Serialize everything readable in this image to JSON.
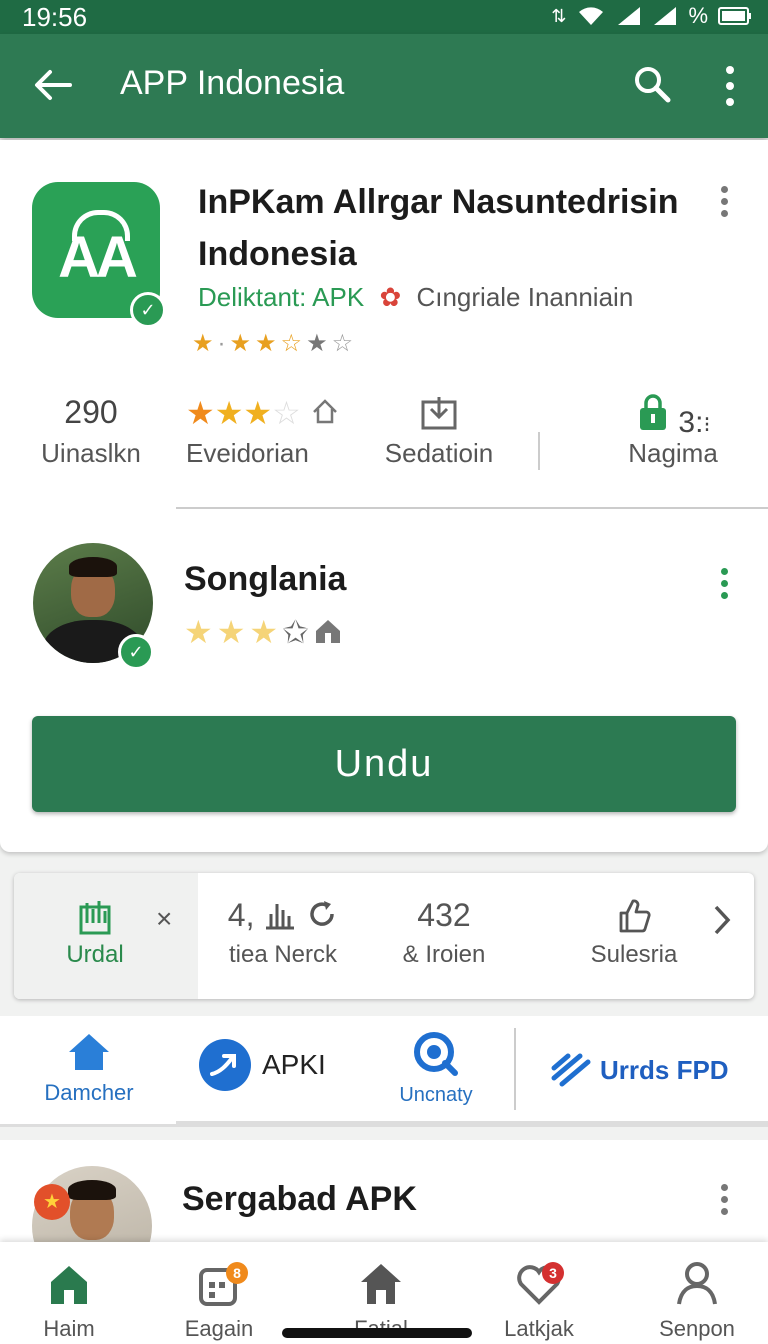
{
  "status_bar": {
    "time": "19:56",
    "battery": "%"
  },
  "app_bar": {
    "title": "APP Indonesia"
  },
  "app": {
    "name": "InPKam Allrgar Nasuntedrisin Indonesia",
    "developer": "Deliktant: APK",
    "category": "Cıngriale Inanniain",
    "rating_stars": 3
  },
  "stats": [
    {
      "value": "290",
      "label": "Uinaslkn"
    },
    {
      "label": "Eveidorian",
      "rating_stars": 3
    },
    {
      "label": "Sedatioin",
      "icon": "download-box-icon"
    },
    {
      "value": "3:",
      "label": "Nagima",
      "icon": "bag-lock-icon"
    }
  ],
  "publisher": {
    "name": "Songlania",
    "rating_stars": 3
  },
  "primary_action": {
    "label": "Undu"
  },
  "quick_actions": {
    "items": [
      {
        "label": "Urdal",
        "icon": "chart-icon"
      },
      {
        "value": "4,",
        "label": "tiea Nerck",
        "icon": "bar-chart-icon"
      },
      {
        "value": "432",
        "label": "& Iroien"
      },
      {
        "label": "Sulesria",
        "icon": "thumbs-up-icon"
      }
    ]
  },
  "category_tabs": [
    {
      "label": "Damcher",
      "icon": "home-icon",
      "active": true
    },
    {
      "label": "APKI",
      "icon": "arrow-circle-icon"
    },
    {
      "label": "Uncnaty",
      "icon": "search-badge-icon"
    },
    {
      "label": "Urrds FPD",
      "icon": "stripes-logo-icon"
    }
  ],
  "list_item": {
    "title": "Sergabad APK"
  },
  "bottom_nav": [
    {
      "label": "Haim",
      "icon": "home-icon",
      "active": true
    },
    {
      "label": "Eagain",
      "icon": "apps-icon",
      "badge": "8"
    },
    {
      "label": "Fatial",
      "icon": "house-icon"
    },
    {
      "label": "Latkjak",
      "icon": "heart-icon",
      "badge": "3"
    },
    {
      "label": "Senpon",
      "icon": "person-icon"
    }
  ],
  "colors": {
    "primary": "#2e7a53",
    "accent": "#2a9a54",
    "star": "#f0a020"
  }
}
